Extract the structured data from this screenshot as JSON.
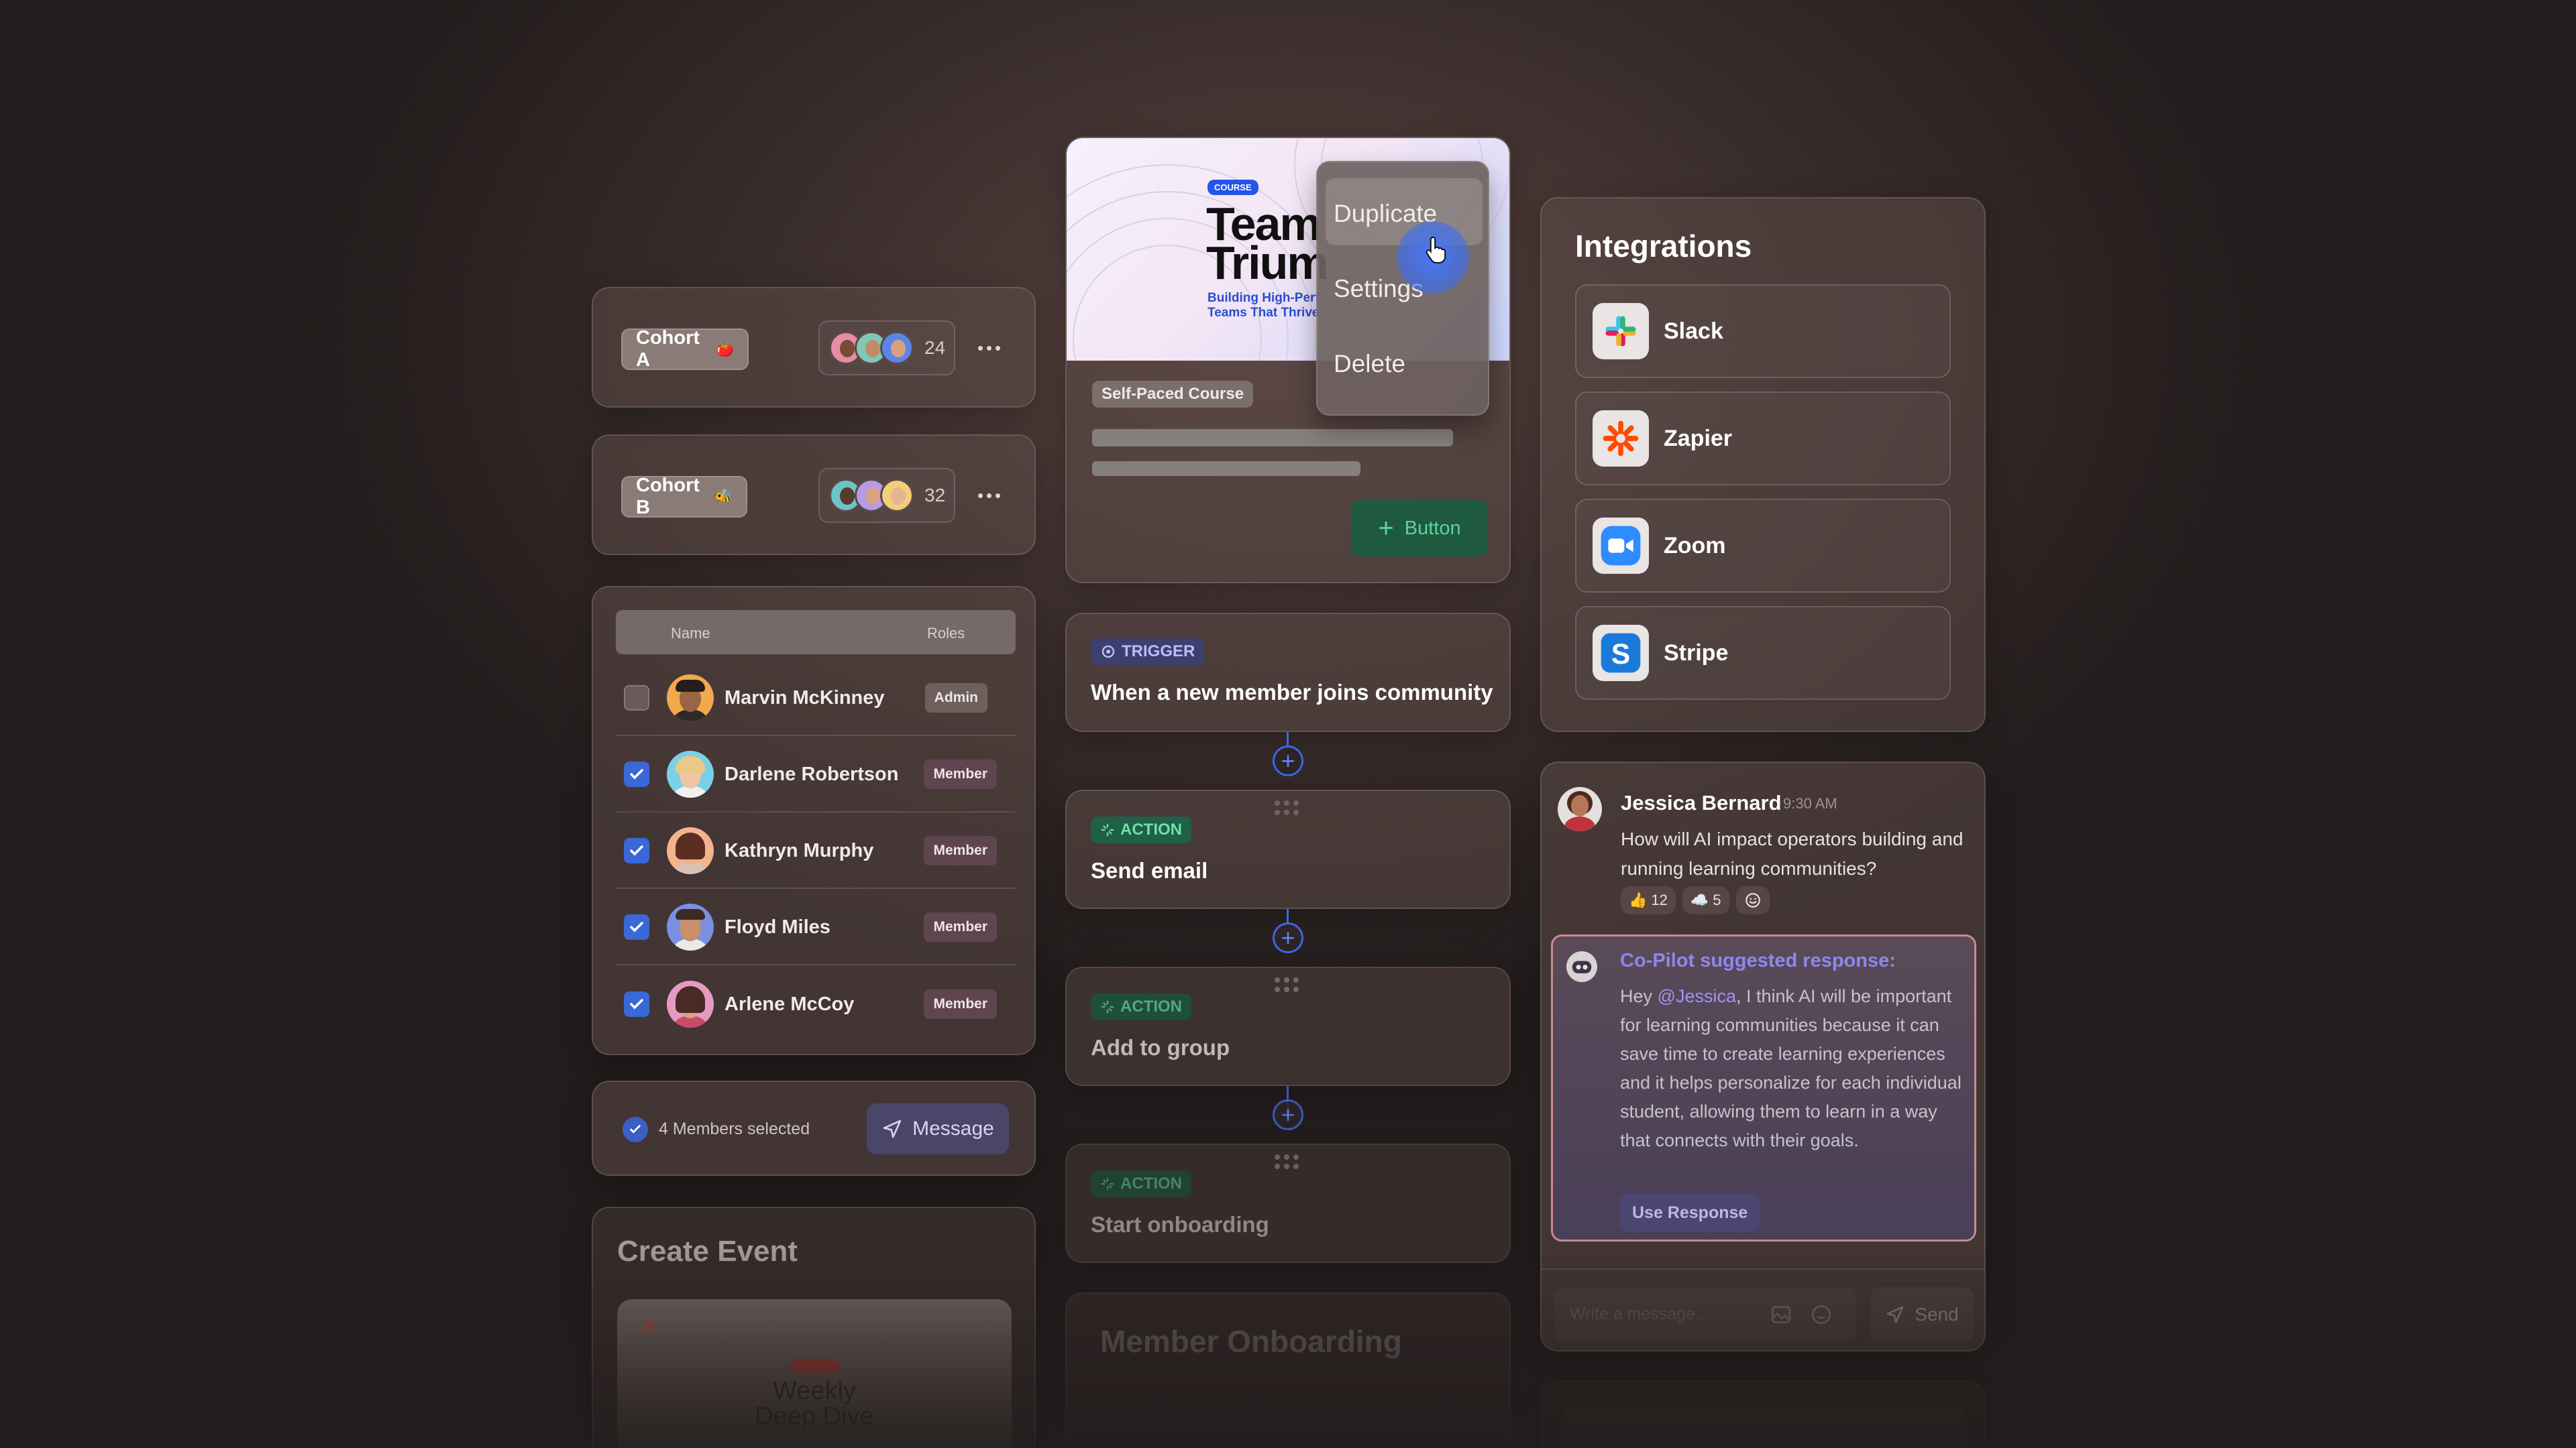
{
  "cohorts": [
    {
      "label": "Cohort A",
      "emoji": "🍅",
      "count": "24"
    },
    {
      "label": "Cohort B",
      "emoji": "🐝",
      "count": "32"
    }
  ],
  "members_table": {
    "headers": {
      "name": "Name",
      "roles": "Roles"
    },
    "rows": [
      {
        "name": "Marvin McKinney",
        "role": "Admin",
        "checked": false
      },
      {
        "name": "Darlene Robertson",
        "role": "Member",
        "checked": true
      },
      {
        "name": "Kathryn Murphy",
        "role": "Member",
        "checked": true
      },
      {
        "name": "Floyd Miles",
        "role": "Member",
        "checked": true
      },
      {
        "name": "Arlene McCoy",
        "role": "Member",
        "checked": true
      }
    ]
  },
  "selection_bar": {
    "text": "4 Members selected",
    "message_label": "Message"
  },
  "create_event": {
    "title": "Create Event",
    "card_title": "Weekly\nDeep Dive"
  },
  "course_card": {
    "badge": "COURSE",
    "title_line1": "Team",
    "title_line2": "Trium",
    "subtitle_line1": "Building High-Perf",
    "subtitle_line2": "Teams That Thrive",
    "type_tag": "Self-Paced Course",
    "button_label": "Button"
  },
  "context_menu": {
    "items": [
      "Duplicate",
      "Settings",
      "Delete"
    ]
  },
  "workflow": [
    {
      "tag": "TRIGGER",
      "title": "When a new member joins community"
    },
    {
      "tag": "ACTION",
      "title": "Send email"
    },
    {
      "tag": "ACTION",
      "title": "Add to group"
    },
    {
      "tag": "ACTION",
      "title": "Start onboarding"
    }
  ],
  "member_onboarding": {
    "title": "Member Onboarding"
  },
  "integrations": {
    "title": "Integrations",
    "items": [
      {
        "name": "Slack",
        "icon": "slack-logo"
      },
      {
        "name": "Zapier",
        "icon": "zapier-logo"
      },
      {
        "name": "Zoom",
        "icon": "zoom-logo"
      },
      {
        "name": "Stripe",
        "icon": "stripe-logo"
      }
    ]
  },
  "chat": {
    "author": "Jessica Bernard",
    "time": "9:30 AM",
    "message": "How will AI impact operators building and running learning communities?",
    "reactions": [
      {
        "emoji": "👍",
        "count": "12"
      },
      {
        "emoji": "☁️",
        "count": "5"
      }
    ],
    "copilot_title": "Co-Pilot suggested response:",
    "copilot_greeting": "Hey ",
    "copilot_mention": "@Jessica",
    "copilot_body": ", I think AI will be important for learning communities because it can save time to create learning experiences and it helps personalize for each individual student, allowing them to learn in a way that connects with their goals.",
    "use_response_label": "Use Response",
    "input_placeholder": "Write a message...",
    "send_label": "Send"
  },
  "colors": {
    "accent_blue": "#3e66e2",
    "action_green": "#1f7a4f",
    "copilot_purple": "#8f86ee"
  }
}
